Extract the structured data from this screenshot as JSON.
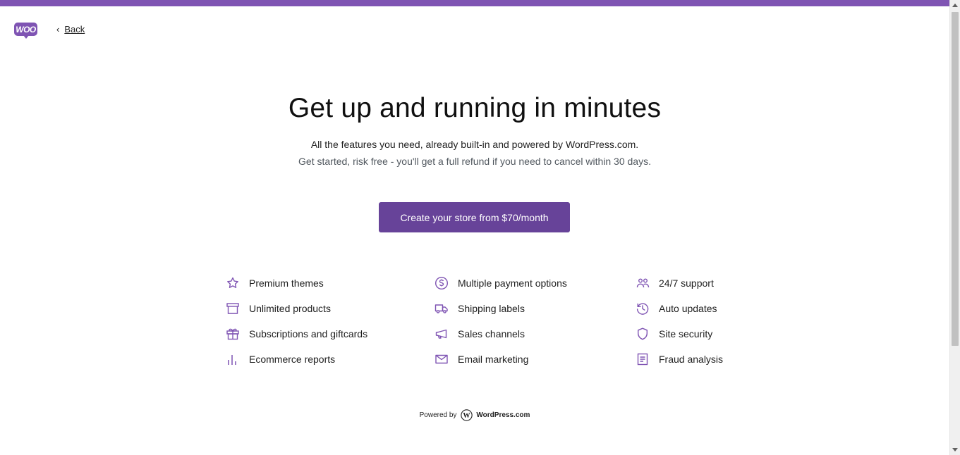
{
  "colors": {
    "brand": "#7f54b3",
    "button": "#674399",
    "icon": "#7f54b3"
  },
  "header": {
    "logo_text": "WOO",
    "back_label": "Back"
  },
  "hero": {
    "title": "Get up and running in minutes",
    "subtitle_1": "All the features you need, already built-in and powered by WordPress.com.",
    "subtitle_2": "Get started, risk free - you'll get a full refund if you need to cancel within 30 days.",
    "cta_label": "Create your store from $70/month"
  },
  "features": {
    "col1": [
      {
        "label": "Premium themes",
        "icon": "star-icon"
      },
      {
        "label": "Unlimited products",
        "icon": "archive-box-icon"
      },
      {
        "label": "Subscriptions and giftcards",
        "icon": "gift-icon"
      },
      {
        "label": "Ecommerce reports",
        "icon": "bar-chart-icon"
      }
    ],
    "col2": [
      {
        "label": "Multiple payment options",
        "icon": "dollar-circle-icon"
      },
      {
        "label": "Shipping labels",
        "icon": "truck-icon"
      },
      {
        "label": "Sales channels",
        "icon": "megaphone-icon"
      },
      {
        "label": "Email marketing",
        "icon": "envelope-icon"
      }
    ],
    "col3": [
      {
        "label": "24/7 support",
        "icon": "people-icon"
      },
      {
        "label": "Auto updates",
        "icon": "history-clock-icon"
      },
      {
        "label": "Site security",
        "icon": "shield-icon"
      },
      {
        "label": "Fraud analysis",
        "icon": "document-icon"
      }
    ]
  },
  "footer": {
    "powered_by": "Powered by",
    "wp_name": "WordPress.com"
  }
}
